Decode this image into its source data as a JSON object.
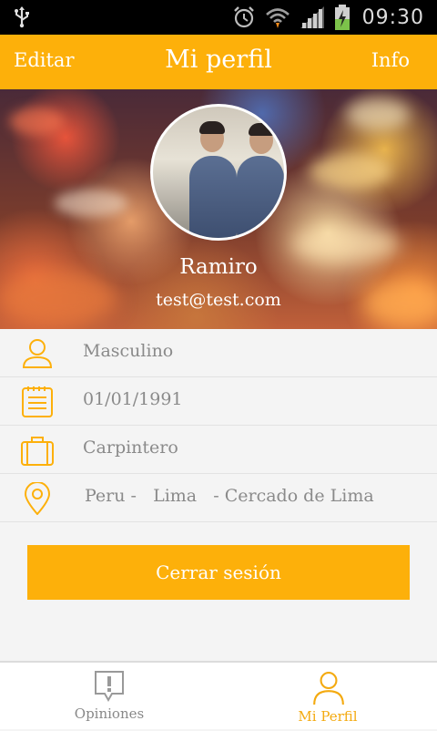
{
  "status_bar": {
    "time": "09:30",
    "icons": [
      "usb-icon",
      "alarm-icon",
      "wifi-icon",
      "signal-icon",
      "battery-charging-icon"
    ]
  },
  "header": {
    "edit_label": "Editar",
    "title": "Mi perfil",
    "info_label": "Info"
  },
  "profile": {
    "name": "Ramiro",
    "email": "test@test.com"
  },
  "details": {
    "gender": "Masculino",
    "birthdate": "01/01/1991",
    "occupation": "Carpintero",
    "location": {
      "country": "Peru",
      "separator1": " -   ",
      "city": "Lima",
      "separator2": "   - ",
      "district": "Cercado de Lima"
    }
  },
  "logout_label": "Cerrar sesión",
  "bottom_nav": {
    "tabs": [
      {
        "label": "Opiniones",
        "icon": "exclamation-speech-icon",
        "active": false
      },
      {
        "label": "Mi Perfil",
        "icon": "person-icon",
        "active": true
      }
    ]
  },
  "colors": {
    "accent": "#fdb00a",
    "text_muted": "#8a8a8a",
    "background": "#f4f4f4"
  }
}
